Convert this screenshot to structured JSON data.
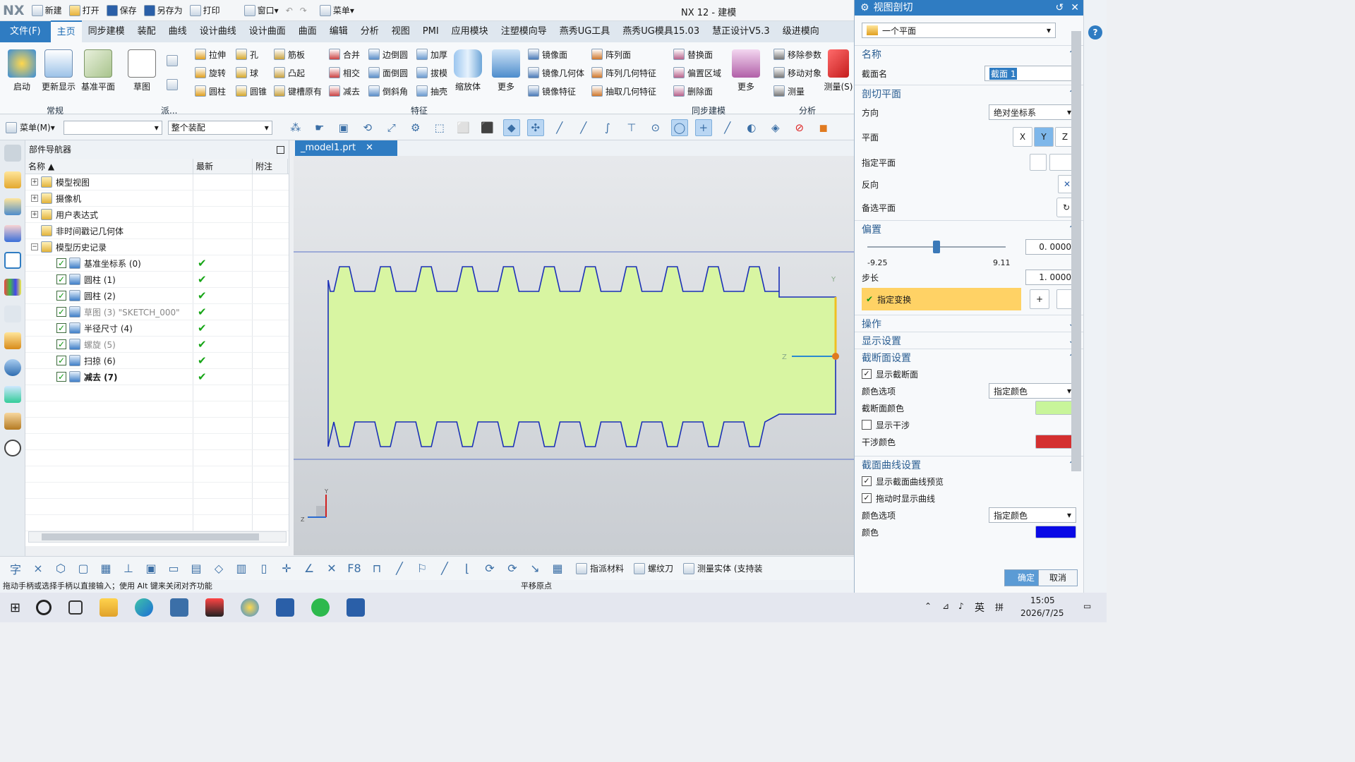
{
  "title": {
    "logo": "NX",
    "window_title": "NX 12 - 建模",
    "quick_access": [
      "新建",
      "打开",
      "保存",
      "另存为",
      "打印"
    ],
    "window_menu": "窗口",
    "menu_button": "菜单"
  },
  "menubar": {
    "file": "文件(F)",
    "tabs": [
      "主页",
      "同步建模",
      "装配",
      "曲线",
      "设计曲线",
      "设计曲面",
      "曲面",
      "编辑",
      "分析",
      "视图",
      "PMI",
      "应用模块",
      "注塑模向导",
      "燕秀UG工具",
      "燕秀UG模具15.03",
      "慧正设计V5.3",
      "级进模向"
    ]
  },
  "ribbon": {
    "big_buttons": [
      "启动",
      "更新显示",
      "基准平面",
      "草图"
    ],
    "group_labels": [
      "常规",
      "派...",
      "特征",
      "同步建模",
      "分析"
    ],
    "feature_col1": [
      "拉伸",
      "旋转",
      "圆柱"
    ],
    "feature_col2": [
      "孔",
      "球",
      "圆锥"
    ],
    "feature_col3": [
      "筋板",
      "凸起",
      "键槽原有"
    ],
    "feature_col4": [
      "合并",
      "相交",
      "减去"
    ],
    "feature_col5": [
      "边倒圆",
      "面倒圆",
      "倒斜角"
    ],
    "feature_col6": [
      "加厚",
      "拔模",
      "抽壳"
    ],
    "feature_big": [
      "缩放体",
      "更多"
    ],
    "mirror_col": [
      "镜像面",
      "镜像几何体",
      "镜像特征"
    ],
    "pattern_col": [
      "阵列面",
      "阵列几何特征",
      "抽取几何特征"
    ],
    "sync_col": [
      "替换面",
      "偏置区域",
      "删除面"
    ],
    "sync_more": "更多",
    "analysis_col": [
      "移除参数",
      "移动对象",
      "测量"
    ],
    "analysis_big": "测量(S)"
  },
  "toolbar": {
    "menu_label": "菜单(M)",
    "filter_value": "",
    "assembly_scope": "整个装配"
  },
  "navigator": {
    "title": "部件导航器",
    "columns": [
      "名称",
      "最新",
      "附注"
    ],
    "rows": [
      {
        "label": "模型视图",
        "check": false,
        "latest": false,
        "style": "normal"
      },
      {
        "label": "摄像机",
        "check": false,
        "latest": false,
        "style": "normal"
      },
      {
        "label": "用户表达式",
        "check": false,
        "latest": false,
        "style": "normal"
      },
      {
        "label": "非时间戳记几何体",
        "check": false,
        "latest": false,
        "style": "normal"
      },
      {
        "label": "模型历史记录",
        "check": false,
        "latest": false,
        "style": "normal"
      },
      {
        "label": "基准坐标系 (0)",
        "check": true,
        "latest": true,
        "style": "normal"
      },
      {
        "label": "圆柱 (1)",
        "check": true,
        "latest": true,
        "style": "normal"
      },
      {
        "label": "圆柱 (2)",
        "check": true,
        "latest": true,
        "style": "normal"
      },
      {
        "label": "草图 (3) \"SKETCH_000\"",
        "check": true,
        "latest": true,
        "style": "gray"
      },
      {
        "label": "半径尺寸 (4)",
        "check": true,
        "latest": true,
        "style": "normal"
      },
      {
        "label": "螺旋 (5)",
        "check": true,
        "latest": true,
        "style": "gray"
      },
      {
        "label": "扫掠 (6)",
        "check": true,
        "latest": true,
        "style": "normal"
      },
      {
        "label": "减去 (7)",
        "check": true,
        "latest": true,
        "style": "bold"
      }
    ]
  },
  "document_tab": "_model1.prt",
  "bottom_tools": {
    "assign_material": "指派材料",
    "thread_tool": "螺纹刀",
    "measure_solid": "测量实体 (支持装"
  },
  "status": {
    "left": "拖动手柄或选择手柄以直接输入；使用 Alt 键来关闭对齐功能",
    "center": "平移原点"
  },
  "dialog": {
    "title": "视图剖切",
    "type_value": "一个平面",
    "sections": {
      "name": "名称",
      "cut_plane": "剖切平面",
      "offset": "偏置",
      "operation": "操作",
      "display": "显示设置",
      "section_settings": "截断面设置",
      "curve_settings": "截面曲线设置"
    },
    "section_name_label": "截面名",
    "section_name_value": "截面 1",
    "direction_label": "方向",
    "direction_value": "绝对坐标系",
    "plane_label": "平面",
    "specify_plane": "指定平面",
    "reverse": "反向",
    "alt_plane": "备选平面",
    "offset_value": "0. 0000",
    "offset_min": "-9.25",
    "offset_max": "9.11",
    "offset_fraction": 0.5,
    "step_label": "步长",
    "step_value": "1. 0000",
    "specify_transform": "指定变换",
    "show_section": "显示截断面",
    "color_option_label": "颜色选项",
    "color_option_value": "指定颜色",
    "section_color_label": "截断面颜色",
    "section_color": "#c8f59a",
    "show_interference": "显示干涉",
    "interference_color_label": "干涉颜色",
    "interference_color": "#d43030",
    "show_curve_preview": "显示截面曲线预览",
    "show_curve_drag": "拖动时显示曲线",
    "curve_color_option": "颜色选项",
    "curve_color_value": "指定颜色",
    "curve_color_label": "颜色",
    "curve_color": "#0a0ae6",
    "ok": "确定",
    "cancel": "取消"
  },
  "taskbar": {
    "input_lang": "英",
    "time": "15:05",
    "date": "2026/7/25"
  },
  "viewport": {
    "tooth_count": 11,
    "profile_fill": "#d8f5a2",
    "profile_stroke": "#1a2fb8"
  }
}
